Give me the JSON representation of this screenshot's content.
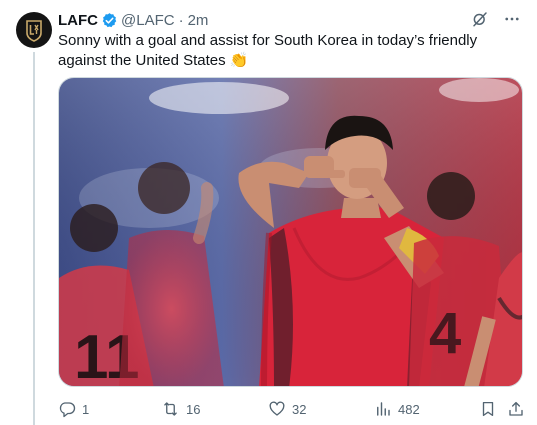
{
  "tweet": {
    "author_name": "LAFC",
    "author_handle": "@LAFC",
    "separator": "·",
    "time": "2m",
    "text": "Sonny with a goal and assist for South Korea in today’s friendly against the United States 👏",
    "avatar_text": "LA FC"
  },
  "media": {
    "jersey_number_left": "11",
    "jersey_number_right": "4"
  },
  "actions": {
    "replies": "1",
    "retweets": "16",
    "likes": "32",
    "views": "482"
  },
  "colors": {
    "verified": "#1d9bf0",
    "text_secondary": "#536471",
    "kit_red": "#d8243a",
    "avatar_bg": "#141414",
    "avatar_gold": "#c9a96a"
  },
  "icons": {
    "verified": "verified-badge-icon",
    "grok": "grok-icon",
    "more": "more-dots-icon",
    "reply": "reply-icon",
    "retweet": "retweet-icon",
    "like": "heart-icon",
    "views": "views-bar-icon",
    "bookmark": "bookmark-icon",
    "share": "share-icon"
  }
}
